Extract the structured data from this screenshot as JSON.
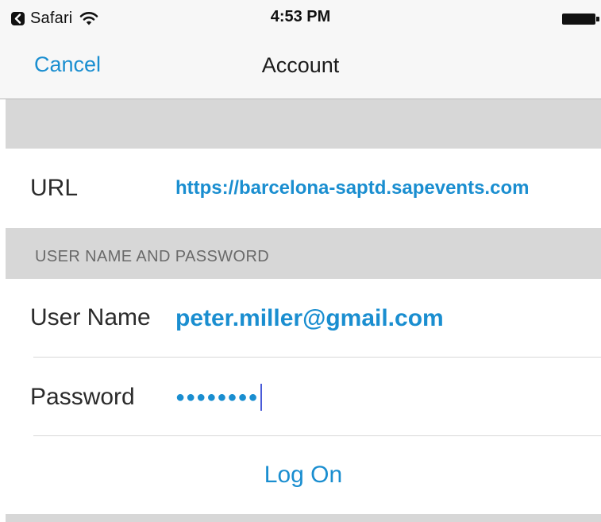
{
  "status_bar": {
    "back_app_label": "Safari",
    "time": "4:53 PM",
    "back_icon": "back-arrow-icon",
    "wifi_icon": "wifi-icon",
    "battery_icon": "battery-icon"
  },
  "nav": {
    "cancel_label": "Cancel",
    "title": "Account"
  },
  "form": {
    "url": {
      "label": "URL",
      "value": "https://barcelona-saptd.sapevents.com"
    },
    "section_header": "USER NAME AND PASSWORD",
    "user_name": {
      "label": "User Name",
      "value": "peter.miller@gmail.com"
    },
    "password": {
      "label": "Password",
      "masked_value": "●●●●●●●●"
    },
    "logon_label": "Log On"
  },
  "colors": {
    "accent": "#1a8ed0",
    "group_background": "#d7d7d7",
    "bar_background": "#f7f7f7"
  }
}
